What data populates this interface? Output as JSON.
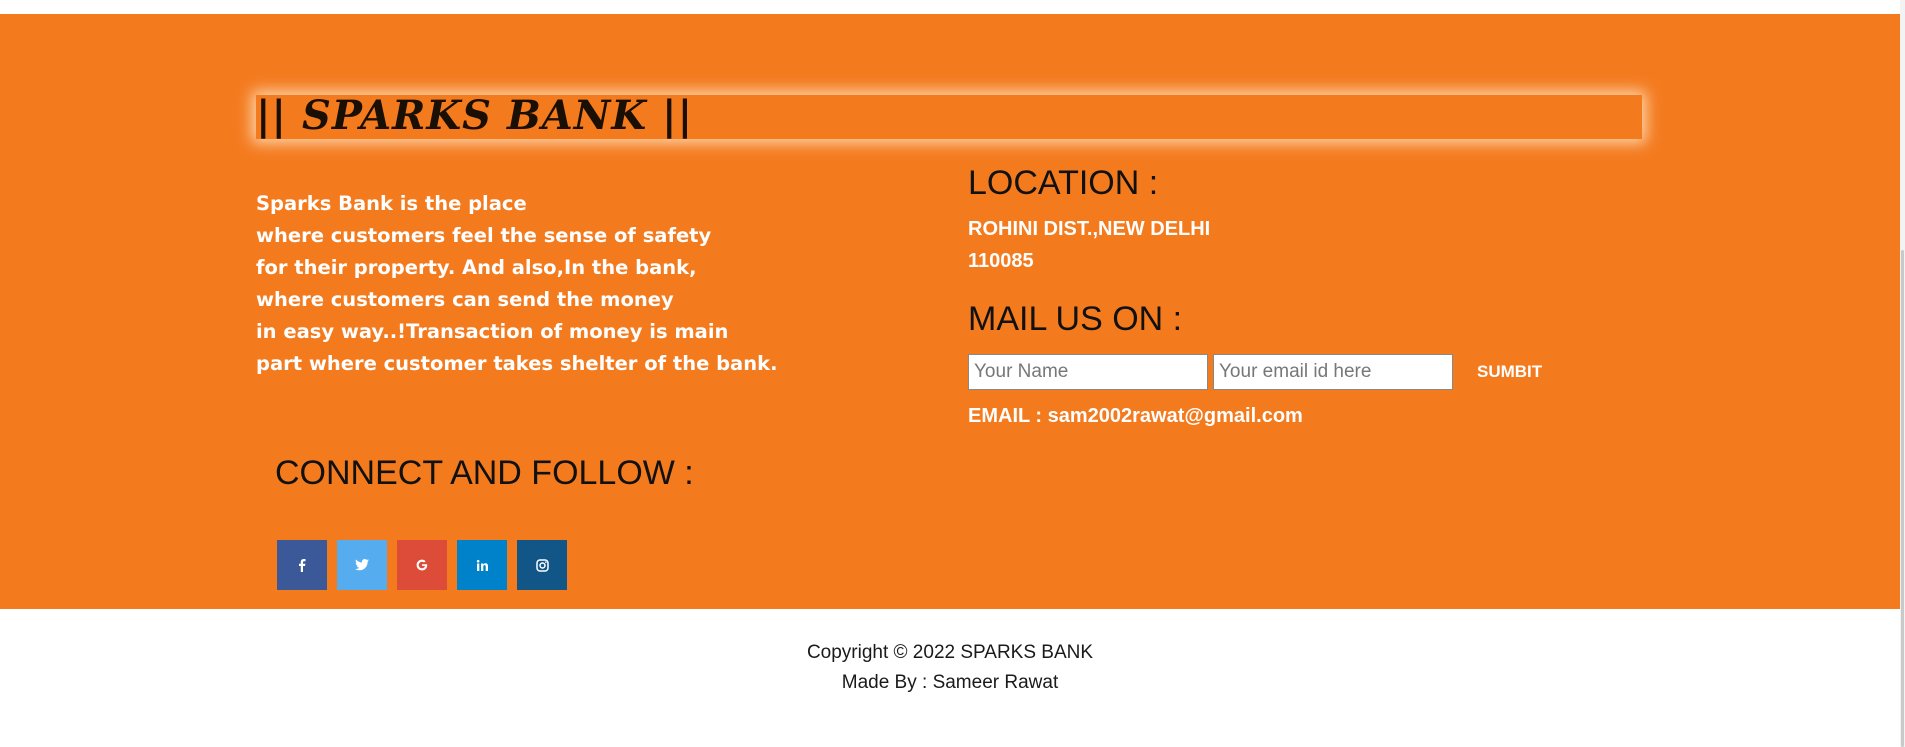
{
  "brand": {
    "title": "|| SPARKS BANK ||"
  },
  "about": {
    "lines": [
      "Sparks Bank is the place",
      "where customers feel the sense of safety",
      "for their property. And also,In the bank,",
      "where customers can send the money",
      "in easy way..!Transaction of money is main",
      "part where customer takes shelter of the bank."
    ]
  },
  "connect": {
    "heading": "CONNECT AND FOLLOW :",
    "socials": [
      {
        "name": "facebook-icon",
        "glyph": "f",
        "color": "#3b5998"
      },
      {
        "name": "twitter-icon",
        "glyph": "twitter",
        "color": "#55acee"
      },
      {
        "name": "google-icon",
        "glyph": "G",
        "color": "#dd4b39"
      },
      {
        "name": "linkedin-icon",
        "glyph": "in",
        "color": "#0082ca"
      },
      {
        "name": "instagram-icon",
        "glyph": "instagram",
        "color": "#125688"
      }
    ]
  },
  "location": {
    "heading": "LOCATION :",
    "address_line1": "ROHINI DIST.,NEW DELHI",
    "address_line2": "110085"
  },
  "mail": {
    "heading": "MAIL US ON :",
    "name_placeholder": "Your Name",
    "email_placeholder": "Your email id here",
    "submit_label": "SUMBIT",
    "email_line": "EMAIL : sam2002rawat@gmail.com"
  },
  "footer": {
    "copyright": "Copyright © 2022 SPARKS BANK",
    "made_by": "Made By : Sameer Rawat"
  },
  "colors": {
    "accent_orange": "#f47a1e",
    "heading_text": "#111111",
    "body_text": "#ffffff"
  }
}
